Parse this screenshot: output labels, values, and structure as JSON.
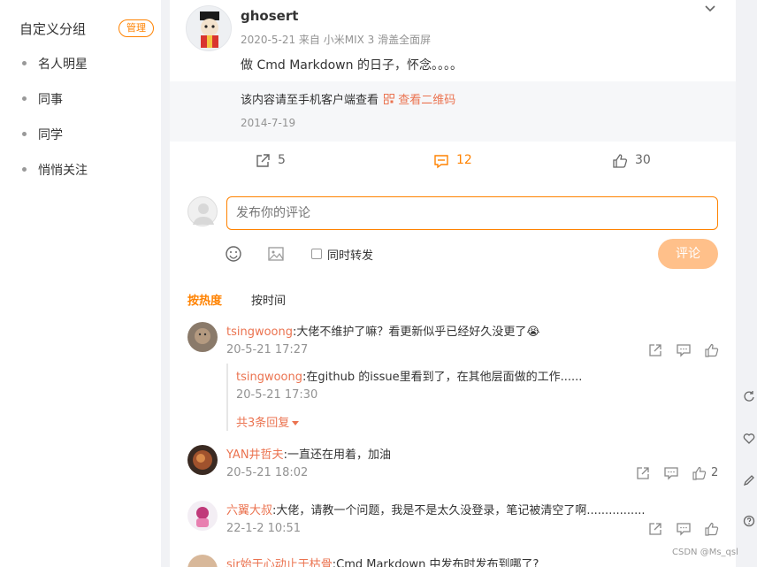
{
  "sidebar": {
    "group_title": "自定义分组",
    "manage_label": "管理",
    "items": [
      {
        "label": "名人明星"
      },
      {
        "label": "同事"
      },
      {
        "label": "同学"
      },
      {
        "label": "悄悄关注"
      }
    ]
  },
  "post": {
    "username": "ghosert",
    "meta": "2020-5-21 来自 小米MIX 3 滑盖全面屏",
    "text": "做 Cmd Markdown 的日子，怀念。。。。",
    "repost_notice": "该内容请至手机客户端查看",
    "qr_link": "查看二维码",
    "repost_date": "2014-7-19",
    "actions": {
      "share_count": "5",
      "comment_count": "12",
      "like_count": "30"
    }
  },
  "composer": {
    "placeholder": "发布你的评论",
    "repost_label": "同时转发",
    "submit_label": "评论"
  },
  "sort_tabs": {
    "hot": "按热度",
    "time": "按时间"
  },
  "comments": [
    {
      "name": "tsingwoong",
      "text": ":大佬不维护了嘛？看更新似乎已经好久没更了😭",
      "time": "20-5-21 17:27",
      "like_count": ""
    },
    {
      "name": "YAN井哲夫",
      "text": ":一直还在用着，加油",
      "time": "20-5-21 18:02",
      "like_count": "2"
    },
    {
      "name": "六翼大叔",
      "text": ":大佬，请教一个问题，我是不是太久没登录，笔记被清空了啊................",
      "time": "22-1-2 10:51",
      "like_count": ""
    },
    {
      "name": "sir始于心动止于枯骨",
      "text": ":Cmd Markdown 中发布时发布到哪了?",
      "time": "",
      "like_count": ""
    }
  ],
  "reply": {
    "name": "tsingwoong",
    "text": ":在github 的issue里看到了，在其他层面做的工作......",
    "time": "20-5-21 17:30",
    "more": "共3条回复"
  },
  "watermark": "CSDN @Ms_qsl",
  "colors": {
    "accent": "#ff8200",
    "link": "#eb7350",
    "muted": "#939393"
  }
}
